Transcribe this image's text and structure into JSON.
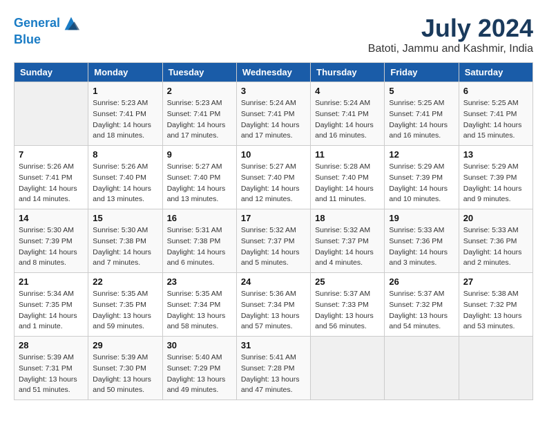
{
  "header": {
    "logo_line1": "General",
    "logo_line2": "Blue",
    "month_year": "July 2024",
    "location": "Batoti, Jammu and Kashmir, India"
  },
  "days_of_week": [
    "Sunday",
    "Monday",
    "Tuesday",
    "Wednesday",
    "Thursday",
    "Friday",
    "Saturday"
  ],
  "weeks": [
    [
      {
        "day": "",
        "info": ""
      },
      {
        "day": "1",
        "info": "Sunrise: 5:23 AM\nSunset: 7:41 PM\nDaylight: 14 hours\nand 18 minutes."
      },
      {
        "day": "2",
        "info": "Sunrise: 5:23 AM\nSunset: 7:41 PM\nDaylight: 14 hours\nand 17 minutes."
      },
      {
        "day": "3",
        "info": "Sunrise: 5:24 AM\nSunset: 7:41 PM\nDaylight: 14 hours\nand 17 minutes."
      },
      {
        "day": "4",
        "info": "Sunrise: 5:24 AM\nSunset: 7:41 PM\nDaylight: 14 hours\nand 16 minutes."
      },
      {
        "day": "5",
        "info": "Sunrise: 5:25 AM\nSunset: 7:41 PM\nDaylight: 14 hours\nand 16 minutes."
      },
      {
        "day": "6",
        "info": "Sunrise: 5:25 AM\nSunset: 7:41 PM\nDaylight: 14 hours\nand 15 minutes."
      }
    ],
    [
      {
        "day": "7",
        "info": "Sunrise: 5:26 AM\nSunset: 7:41 PM\nDaylight: 14 hours\nand 14 minutes."
      },
      {
        "day": "8",
        "info": "Sunrise: 5:26 AM\nSunset: 7:40 PM\nDaylight: 14 hours\nand 13 minutes."
      },
      {
        "day": "9",
        "info": "Sunrise: 5:27 AM\nSunset: 7:40 PM\nDaylight: 14 hours\nand 13 minutes."
      },
      {
        "day": "10",
        "info": "Sunrise: 5:27 AM\nSunset: 7:40 PM\nDaylight: 14 hours\nand 12 minutes."
      },
      {
        "day": "11",
        "info": "Sunrise: 5:28 AM\nSunset: 7:40 PM\nDaylight: 14 hours\nand 11 minutes."
      },
      {
        "day": "12",
        "info": "Sunrise: 5:29 AM\nSunset: 7:39 PM\nDaylight: 14 hours\nand 10 minutes."
      },
      {
        "day": "13",
        "info": "Sunrise: 5:29 AM\nSunset: 7:39 PM\nDaylight: 14 hours\nand 9 minutes."
      }
    ],
    [
      {
        "day": "14",
        "info": "Sunrise: 5:30 AM\nSunset: 7:39 PM\nDaylight: 14 hours\nand 8 minutes."
      },
      {
        "day": "15",
        "info": "Sunrise: 5:30 AM\nSunset: 7:38 PM\nDaylight: 14 hours\nand 7 minutes."
      },
      {
        "day": "16",
        "info": "Sunrise: 5:31 AM\nSunset: 7:38 PM\nDaylight: 14 hours\nand 6 minutes."
      },
      {
        "day": "17",
        "info": "Sunrise: 5:32 AM\nSunset: 7:37 PM\nDaylight: 14 hours\nand 5 minutes."
      },
      {
        "day": "18",
        "info": "Sunrise: 5:32 AM\nSunset: 7:37 PM\nDaylight: 14 hours\nand 4 minutes."
      },
      {
        "day": "19",
        "info": "Sunrise: 5:33 AM\nSunset: 7:36 PM\nDaylight: 14 hours\nand 3 minutes."
      },
      {
        "day": "20",
        "info": "Sunrise: 5:33 AM\nSunset: 7:36 PM\nDaylight: 14 hours\nand 2 minutes."
      }
    ],
    [
      {
        "day": "21",
        "info": "Sunrise: 5:34 AM\nSunset: 7:35 PM\nDaylight: 14 hours\nand 1 minute."
      },
      {
        "day": "22",
        "info": "Sunrise: 5:35 AM\nSunset: 7:35 PM\nDaylight: 13 hours\nand 59 minutes."
      },
      {
        "day": "23",
        "info": "Sunrise: 5:35 AM\nSunset: 7:34 PM\nDaylight: 13 hours\nand 58 minutes."
      },
      {
        "day": "24",
        "info": "Sunrise: 5:36 AM\nSunset: 7:34 PM\nDaylight: 13 hours\nand 57 minutes."
      },
      {
        "day": "25",
        "info": "Sunrise: 5:37 AM\nSunset: 7:33 PM\nDaylight: 13 hours\nand 56 minutes."
      },
      {
        "day": "26",
        "info": "Sunrise: 5:37 AM\nSunset: 7:32 PM\nDaylight: 13 hours\nand 54 minutes."
      },
      {
        "day": "27",
        "info": "Sunrise: 5:38 AM\nSunset: 7:32 PM\nDaylight: 13 hours\nand 53 minutes."
      }
    ],
    [
      {
        "day": "28",
        "info": "Sunrise: 5:39 AM\nSunset: 7:31 PM\nDaylight: 13 hours\nand 51 minutes."
      },
      {
        "day": "29",
        "info": "Sunrise: 5:39 AM\nSunset: 7:30 PM\nDaylight: 13 hours\nand 50 minutes."
      },
      {
        "day": "30",
        "info": "Sunrise: 5:40 AM\nSunset: 7:29 PM\nDaylight: 13 hours\nand 49 minutes."
      },
      {
        "day": "31",
        "info": "Sunrise: 5:41 AM\nSunset: 7:28 PM\nDaylight: 13 hours\nand 47 minutes."
      },
      {
        "day": "",
        "info": ""
      },
      {
        "day": "",
        "info": ""
      },
      {
        "day": "",
        "info": ""
      }
    ]
  ]
}
